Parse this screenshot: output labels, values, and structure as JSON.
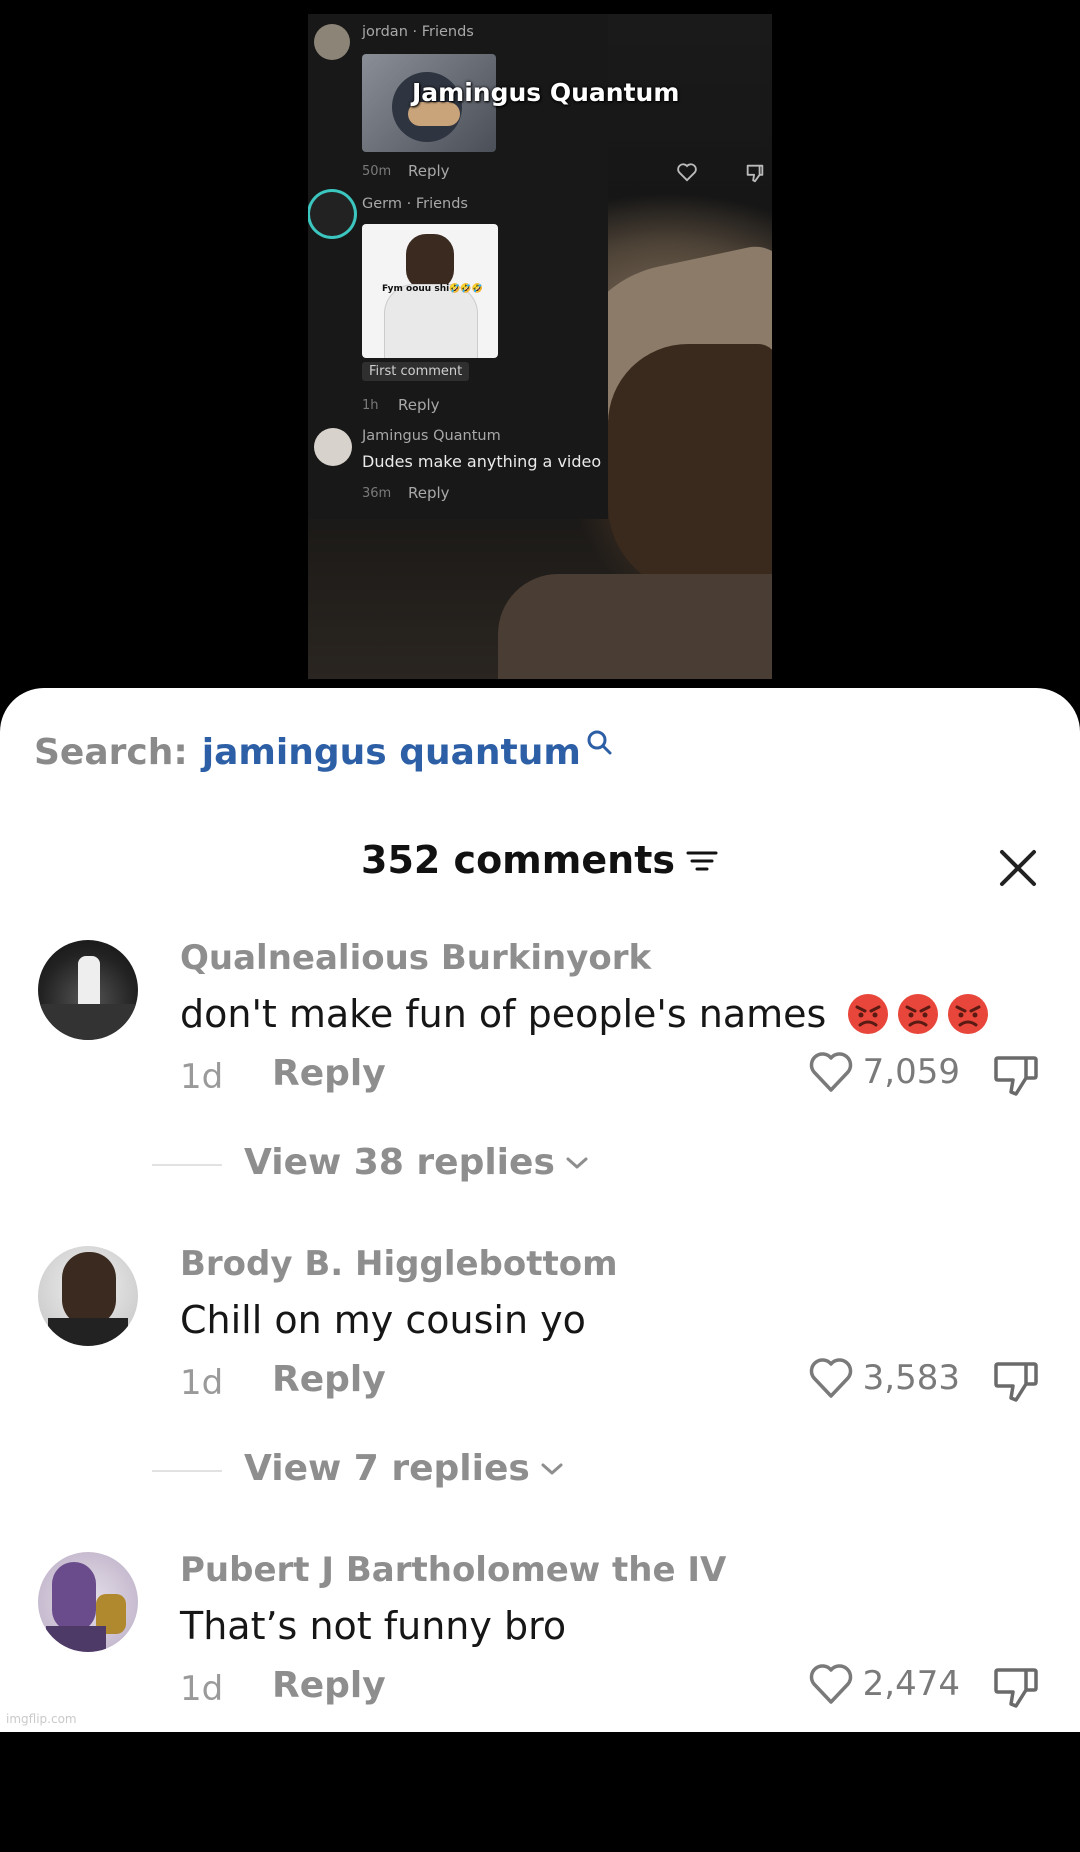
{
  "video": {
    "comments": [
      {
        "user": "jordan · Friends",
        "sticker_text": "Jamingus Quantum",
        "time": "50m",
        "reply": "Reply"
      },
      {
        "user": "Germ · Friends",
        "sticker_caption": "Fym oouu shi🤣🤣🤣",
        "badge": "First comment",
        "time": "1h",
        "reply": "Reply"
      },
      {
        "user": "Jamingus Quantum",
        "text": "Dudes make anything a video",
        "time": "36m",
        "reply": "Reply"
      }
    ]
  },
  "search": {
    "label": "Search:",
    "query": "jamingus quantum"
  },
  "header": {
    "title": "352 comments"
  },
  "comments": [
    {
      "name": "Qualnealious Burkinyork",
      "text": "don't make fun of people's names",
      "emoji": [
        "angry-face",
        "angry-face",
        "angry-face"
      ],
      "time": "1d",
      "reply": "Reply",
      "likes": "7,059",
      "view_replies": "View 38 replies"
    },
    {
      "name": "Brody B. Higglebottom",
      "text": "Chill on my cousin yo",
      "time": "1d",
      "reply": "Reply",
      "likes": "3,583",
      "view_replies": "View 7 replies"
    },
    {
      "name": "Pubert J Bartholomew the IV",
      "text": "That’s not funny bro",
      "time": "1d",
      "reply": "Reply",
      "likes": "2,474"
    }
  ],
  "watermark": "imgflip.com",
  "colors": {
    "link_blue": "#2d5fa6",
    "muted": "#8e8e8e",
    "emoji_red": "#e8463a"
  }
}
